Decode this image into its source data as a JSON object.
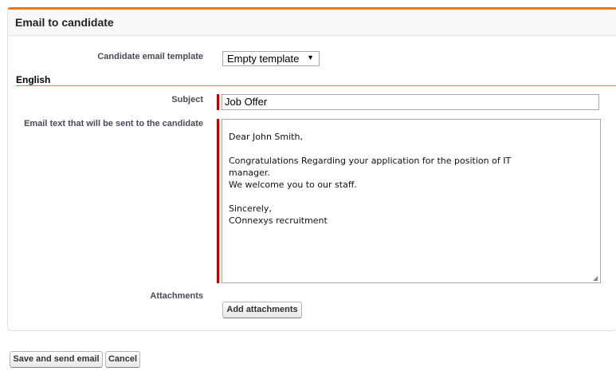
{
  "panel": {
    "title": "Email to candidate"
  },
  "template": {
    "label": "Candidate email template",
    "selected": "Empty template"
  },
  "section": {
    "title": "English"
  },
  "subject": {
    "label": "Subject",
    "value": "Job Offer"
  },
  "body": {
    "label": "Email text that will be sent to the candidate",
    "lines": [
      "Dear John Smith,",
      "",
      "Congratulations Regarding your application for the position of IT",
      "manager.",
      "We welcome you to our staff.",
      "",
      "Sincerely,",
      "COnnexys recruitment"
    ]
  },
  "attachments": {
    "label": "Attachments",
    "button_label": "Add attachments"
  },
  "footer": {
    "save_label": "Save and send email",
    "cancel_label": "Cancel"
  },
  "colors": {
    "accent": "#e8771e",
    "required": "#c00000"
  }
}
